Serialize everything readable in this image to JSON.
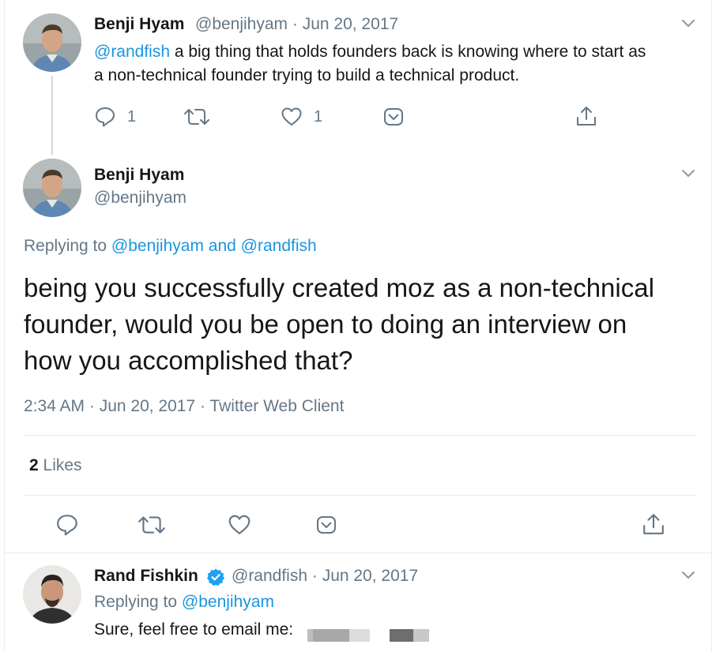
{
  "tweet1": {
    "author_name": "Benji Hyam",
    "handle_date": "@benjihyam · Jun 20, 2017",
    "mention": "@randfish",
    "text_line1_rest": " a big thing that holds founders back is knowing where to start as",
    "text_line2": "a non-technical founder trying to build a technical product.",
    "reply_count": "1",
    "like_count": "1"
  },
  "tweet2": {
    "author_name": "Benji Hyam",
    "handle": "@benjihyam",
    "replying_prefix": "Replying to ",
    "replying_to": "@benjihyam and @randfish",
    "text_line1": "being you successfully created moz as a non-technical",
    "text_line2": "founder, would you be open to doing an interview on",
    "text_line3": "how you accomplished that?",
    "timestamp": "2:34 AM · Jun 20, 2017 · Twitter Web Client",
    "likes_count": "2",
    "likes_label": " Likes"
  },
  "tweet3": {
    "author_name": "Rand Fishkin",
    "handle_date": "@randfish · Jun 20, 2017",
    "replying_prefix": "Replying to ",
    "replying_to": "@benjihyam",
    "text": "Sure, feel free to email me: "
  },
  "colors": {
    "link": "#1b95e0",
    "secondary_text": "#657786",
    "verified": "#1da1f2",
    "divider": "#e6ecf0"
  },
  "icons": [
    "chevron-down-icon",
    "reply-icon",
    "retweet-icon",
    "like-icon",
    "dm-icon",
    "share-icon",
    "verified-badge-icon"
  ]
}
